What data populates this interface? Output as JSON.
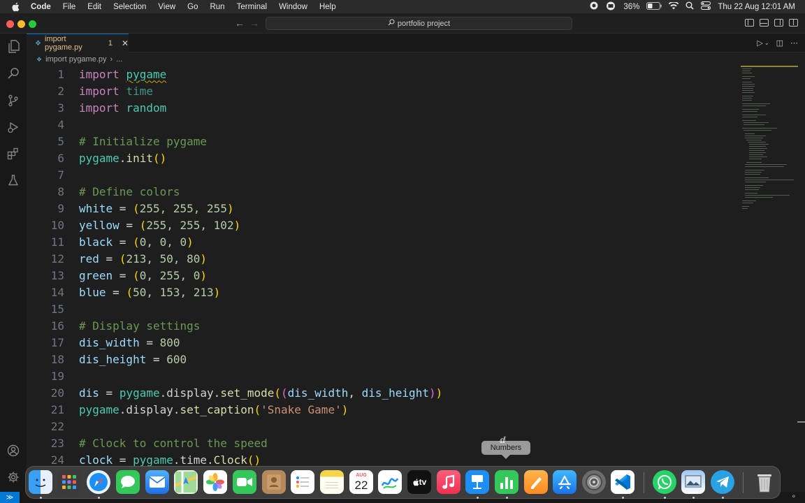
{
  "menubar": {
    "app_name": "Code",
    "items": [
      "File",
      "Edit",
      "Selection",
      "View",
      "Go",
      "Run",
      "Terminal",
      "Window",
      "Help"
    ],
    "battery": "36%",
    "datetime": "Thu 22 Aug  12:01 AM"
  },
  "titlebar": {
    "search_text": "portfolio project"
  },
  "tab": {
    "label": "import pygame.py",
    "problems": "1"
  },
  "breadcrumb": {
    "file": "import pygame.py",
    "more": "..."
  },
  "editor": {
    "lines": [
      {
        "n": "1",
        "kw": "import",
        "mod": "pygame"
      },
      {
        "n": "2",
        "kw": "import",
        "mod": "time"
      },
      {
        "n": "3",
        "kw": "import",
        "mod": "random"
      },
      {
        "n": "4"
      },
      {
        "n": "5",
        "comment": "# Initialize pygame"
      },
      {
        "n": "6",
        "a": "pygame",
        "b": ".init",
        "c": "()"
      },
      {
        "n": "7"
      },
      {
        "n": "8",
        "comment": "# Define colors"
      },
      {
        "n": "9",
        "var": "white",
        "eq": " = ",
        "open": "(",
        "vals": "255, 255, 255",
        "close": ")"
      },
      {
        "n": "10",
        "var": "yellow",
        "eq": " = ",
        "open": "(",
        "vals": "255, 255, 102",
        "close": ")"
      },
      {
        "n": "11",
        "var": "black",
        "eq": " = ",
        "open": "(",
        "vals": "0, 0, 0",
        "close": ")"
      },
      {
        "n": "12",
        "var": "red",
        "eq": " = ",
        "open": "(",
        "vals": "213, 50, 80",
        "close": ")"
      },
      {
        "n": "13",
        "var": "green",
        "eq": " = ",
        "open": "(",
        "vals": "0, 255, 0",
        "close": ")"
      },
      {
        "n": "14",
        "var": "blue",
        "eq": " = ",
        "open": "(",
        "vals": "50, 153, 213",
        "close": ")"
      },
      {
        "n": "15"
      },
      {
        "n": "16",
        "comment": "# Display settings"
      },
      {
        "n": "17",
        "var": "dis_width",
        "eq": " = ",
        "val": "800"
      },
      {
        "n": "18",
        "var": "dis_height",
        "eq": " = ",
        "val": "600"
      },
      {
        "n": "19"
      },
      {
        "n": "20",
        "var": "dis",
        "eq": " = ",
        "mod": "pygame",
        "mid": ".display.",
        "fn": "set_mode",
        "o1": "(",
        "o2": "(",
        "a1": "dis_width",
        "sep": ", ",
        "a2": "dis_height",
        "c2": ")",
        "c1": ")"
      },
      {
        "n": "21",
        "mod": "pygame",
        "mid": ".display.",
        "fn": "set_caption",
        "o1": "(",
        "str": "'Snake Game'",
        "c1": ")"
      },
      {
        "n": "22"
      },
      {
        "n": "23",
        "comment": "# Clock to control the speed"
      },
      {
        "n": "24",
        "var": "clock",
        "eq": " = ",
        "mod": "pygame",
        "mid": ".time.",
        "fn": "Clock",
        "o1": "(",
        "c1": ")"
      }
    ]
  },
  "tooltip": "Numbers",
  "dock": {
    "calendar_month": "AUG",
    "calendar_day": "22",
    "tv_label": "tv"
  },
  "colors": {
    "accent": "#0078d4",
    "keyword": "#c586c0",
    "module": "#4ec9b0",
    "comment": "#6a9955"
  }
}
